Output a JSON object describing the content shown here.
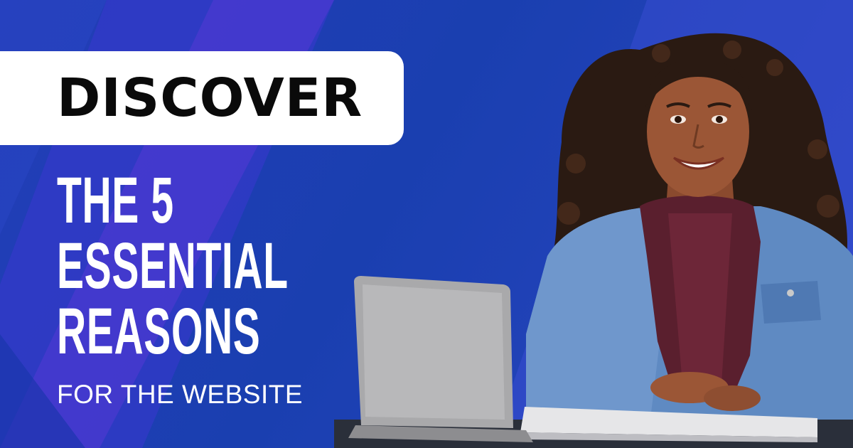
{
  "banner": {
    "pill_text": "DISCOVER",
    "headline": [
      "THE 5",
      "ESSENTIAL",
      "REASONS"
    ],
    "subline": "FOR THE WEBSITE"
  },
  "photo": {
    "subject": "smiling-woman-with-laptop-illustration"
  },
  "colors": {
    "background": "#1a3fb3",
    "stripe_light": "#3b5de0",
    "stripe_purple": "#5a3cd8",
    "pill": "#ffffff",
    "pill_text": "#0a0a0a",
    "headline_text": "#ffffff"
  }
}
